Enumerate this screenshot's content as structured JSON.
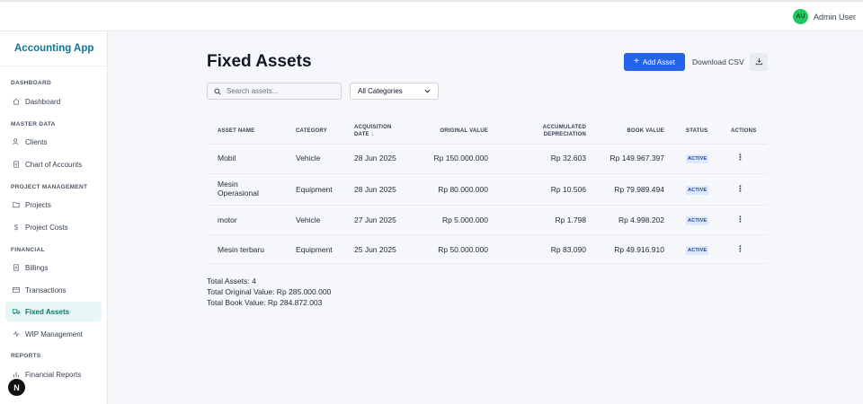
{
  "header": {
    "user_initials": "AU",
    "user_name": "Admin User"
  },
  "sidebar": {
    "brand": "Accounting App",
    "sections": [
      "DASHBOARD",
      "MASTER DATA",
      "PROJECT MANAGEMENT",
      "FINANCIAL",
      "REPORTS"
    ],
    "items": [
      {
        "label": "Dashboard",
        "icon": "home-icon"
      },
      {
        "label": "Clients",
        "icon": "users-icon"
      },
      {
        "label": "Chart of Accounts",
        "icon": "document-icon"
      },
      {
        "label": "Projects",
        "icon": "folder-icon"
      },
      {
        "label": "Project Costs",
        "icon": "dollar-icon"
      },
      {
        "label": "Billings",
        "icon": "document-icon"
      },
      {
        "label": "Transactions",
        "icon": "card-icon"
      },
      {
        "label": "Fixed Assets",
        "icon": "truck-icon",
        "active": true
      },
      {
        "label": "WIP Management",
        "icon": "activity-icon"
      },
      {
        "label": "Financial Reports",
        "icon": "bar-chart-icon"
      }
    ],
    "badge": "N"
  },
  "page": {
    "title": "Fixed Assets",
    "add_button": "Add Asset",
    "csv_button": "Download CSV",
    "search_placeholder": "Search assets...",
    "category_selected": "All Categories"
  },
  "table": {
    "headers": {
      "name": "ASSET NAME",
      "category": "CATEGORY",
      "acq1": "ACQUISITION",
      "acq2": "DATE ↓",
      "original": "ORIGINAL VALUE",
      "acc1": "ACCUMULATED",
      "acc2": "DEPRECIATION",
      "book": "BOOK VALUE",
      "status": "STATUS",
      "actions": "ACTIONS"
    },
    "rows": [
      {
        "name": "Mobil",
        "category": "Vehicle",
        "date": "28 Jun 2025",
        "original": "Rp 150.000.000",
        "depreciation": "Rp 32.603",
        "book": "Rp 149.967.397",
        "status": "ACTIVE"
      },
      {
        "name": "Mesin Operasional",
        "category": "Equipment",
        "date": "28 Jun 2025",
        "original": "Rp 80.000.000",
        "depreciation": "Rp 10.506",
        "book": "Rp 79.989.494",
        "status": "ACTIVE"
      },
      {
        "name": "motor",
        "category": "Vehicle",
        "date": "27 Jun 2025",
        "original": "Rp 5.000.000",
        "depreciation": "Rp 1.798",
        "book": "Rp 4.998.202",
        "status": "ACTIVE"
      },
      {
        "name": "Mesin terbaru",
        "category": "Equipment",
        "date": "25 Jun 2025",
        "original": "Rp 50.000.000",
        "depreciation": "Rp 83.090",
        "book": "Rp 49.916.910",
        "status": "ACTIVE"
      }
    ]
  },
  "summary": {
    "total_assets": "Total Assets: 4",
    "total_original": "Total Original Value: Rp 285.000.000",
    "total_book": "Total Book Value: Rp 284.872.003"
  }
}
